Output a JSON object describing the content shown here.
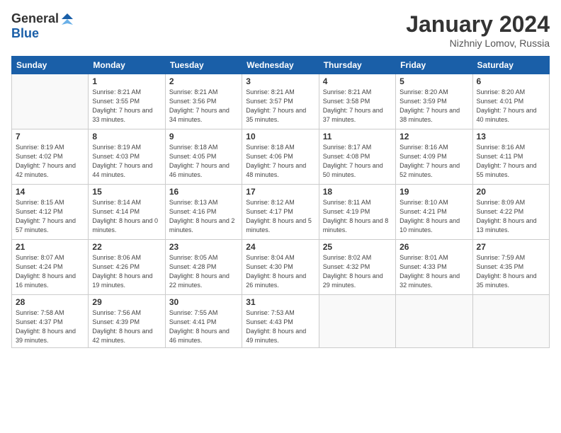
{
  "logo": {
    "general": "General",
    "blue": "Blue"
  },
  "header": {
    "month": "January 2024",
    "location": "Nizhniy Lomov, Russia"
  },
  "weekdays": [
    "Sunday",
    "Monday",
    "Tuesday",
    "Wednesday",
    "Thursday",
    "Friday",
    "Saturday"
  ],
  "weeks": [
    [
      {
        "day": "",
        "sunrise": "",
        "sunset": "",
        "daylight": ""
      },
      {
        "day": "1",
        "sunrise": "Sunrise: 8:21 AM",
        "sunset": "Sunset: 3:55 PM",
        "daylight": "Daylight: 7 hours and 33 minutes."
      },
      {
        "day": "2",
        "sunrise": "Sunrise: 8:21 AM",
        "sunset": "Sunset: 3:56 PM",
        "daylight": "Daylight: 7 hours and 34 minutes."
      },
      {
        "day": "3",
        "sunrise": "Sunrise: 8:21 AM",
        "sunset": "Sunset: 3:57 PM",
        "daylight": "Daylight: 7 hours and 35 minutes."
      },
      {
        "day": "4",
        "sunrise": "Sunrise: 8:21 AM",
        "sunset": "Sunset: 3:58 PM",
        "daylight": "Daylight: 7 hours and 37 minutes."
      },
      {
        "day": "5",
        "sunrise": "Sunrise: 8:20 AM",
        "sunset": "Sunset: 3:59 PM",
        "daylight": "Daylight: 7 hours and 38 minutes."
      },
      {
        "day": "6",
        "sunrise": "Sunrise: 8:20 AM",
        "sunset": "Sunset: 4:01 PM",
        "daylight": "Daylight: 7 hours and 40 minutes."
      }
    ],
    [
      {
        "day": "7",
        "sunrise": "Sunrise: 8:19 AM",
        "sunset": "Sunset: 4:02 PM",
        "daylight": "Daylight: 7 hours and 42 minutes."
      },
      {
        "day": "8",
        "sunrise": "Sunrise: 8:19 AM",
        "sunset": "Sunset: 4:03 PM",
        "daylight": "Daylight: 7 hours and 44 minutes."
      },
      {
        "day": "9",
        "sunrise": "Sunrise: 8:18 AM",
        "sunset": "Sunset: 4:05 PM",
        "daylight": "Daylight: 7 hours and 46 minutes."
      },
      {
        "day": "10",
        "sunrise": "Sunrise: 8:18 AM",
        "sunset": "Sunset: 4:06 PM",
        "daylight": "Daylight: 7 hours and 48 minutes."
      },
      {
        "day": "11",
        "sunrise": "Sunrise: 8:17 AM",
        "sunset": "Sunset: 4:08 PM",
        "daylight": "Daylight: 7 hours and 50 minutes."
      },
      {
        "day": "12",
        "sunrise": "Sunrise: 8:16 AM",
        "sunset": "Sunset: 4:09 PM",
        "daylight": "Daylight: 7 hours and 52 minutes."
      },
      {
        "day": "13",
        "sunrise": "Sunrise: 8:16 AM",
        "sunset": "Sunset: 4:11 PM",
        "daylight": "Daylight: 7 hours and 55 minutes."
      }
    ],
    [
      {
        "day": "14",
        "sunrise": "Sunrise: 8:15 AM",
        "sunset": "Sunset: 4:12 PM",
        "daylight": "Daylight: 7 hours and 57 minutes."
      },
      {
        "day": "15",
        "sunrise": "Sunrise: 8:14 AM",
        "sunset": "Sunset: 4:14 PM",
        "daylight": "Daylight: 8 hours and 0 minutes."
      },
      {
        "day": "16",
        "sunrise": "Sunrise: 8:13 AM",
        "sunset": "Sunset: 4:16 PM",
        "daylight": "Daylight: 8 hours and 2 minutes."
      },
      {
        "day": "17",
        "sunrise": "Sunrise: 8:12 AM",
        "sunset": "Sunset: 4:17 PM",
        "daylight": "Daylight: 8 hours and 5 minutes."
      },
      {
        "day": "18",
        "sunrise": "Sunrise: 8:11 AM",
        "sunset": "Sunset: 4:19 PM",
        "daylight": "Daylight: 8 hours and 8 minutes."
      },
      {
        "day": "19",
        "sunrise": "Sunrise: 8:10 AM",
        "sunset": "Sunset: 4:21 PM",
        "daylight": "Daylight: 8 hours and 10 minutes."
      },
      {
        "day": "20",
        "sunrise": "Sunrise: 8:09 AM",
        "sunset": "Sunset: 4:22 PM",
        "daylight": "Daylight: 8 hours and 13 minutes."
      }
    ],
    [
      {
        "day": "21",
        "sunrise": "Sunrise: 8:07 AM",
        "sunset": "Sunset: 4:24 PM",
        "daylight": "Daylight: 8 hours and 16 minutes."
      },
      {
        "day": "22",
        "sunrise": "Sunrise: 8:06 AM",
        "sunset": "Sunset: 4:26 PM",
        "daylight": "Daylight: 8 hours and 19 minutes."
      },
      {
        "day": "23",
        "sunrise": "Sunrise: 8:05 AM",
        "sunset": "Sunset: 4:28 PM",
        "daylight": "Daylight: 8 hours and 22 minutes."
      },
      {
        "day": "24",
        "sunrise": "Sunrise: 8:04 AM",
        "sunset": "Sunset: 4:30 PM",
        "daylight": "Daylight: 8 hours and 26 minutes."
      },
      {
        "day": "25",
        "sunrise": "Sunrise: 8:02 AM",
        "sunset": "Sunset: 4:32 PM",
        "daylight": "Daylight: 8 hours and 29 minutes."
      },
      {
        "day": "26",
        "sunrise": "Sunrise: 8:01 AM",
        "sunset": "Sunset: 4:33 PM",
        "daylight": "Daylight: 8 hours and 32 minutes."
      },
      {
        "day": "27",
        "sunrise": "Sunrise: 7:59 AM",
        "sunset": "Sunset: 4:35 PM",
        "daylight": "Daylight: 8 hours and 35 minutes."
      }
    ],
    [
      {
        "day": "28",
        "sunrise": "Sunrise: 7:58 AM",
        "sunset": "Sunset: 4:37 PM",
        "daylight": "Daylight: 8 hours and 39 minutes."
      },
      {
        "day": "29",
        "sunrise": "Sunrise: 7:56 AM",
        "sunset": "Sunset: 4:39 PM",
        "daylight": "Daylight: 8 hours and 42 minutes."
      },
      {
        "day": "30",
        "sunrise": "Sunrise: 7:55 AM",
        "sunset": "Sunset: 4:41 PM",
        "daylight": "Daylight: 8 hours and 46 minutes."
      },
      {
        "day": "31",
        "sunrise": "Sunrise: 7:53 AM",
        "sunset": "Sunset: 4:43 PM",
        "daylight": "Daylight: 8 hours and 49 minutes."
      },
      {
        "day": "",
        "sunrise": "",
        "sunset": "",
        "daylight": ""
      },
      {
        "day": "",
        "sunrise": "",
        "sunset": "",
        "daylight": ""
      },
      {
        "day": "",
        "sunrise": "",
        "sunset": "",
        "daylight": ""
      }
    ]
  ]
}
